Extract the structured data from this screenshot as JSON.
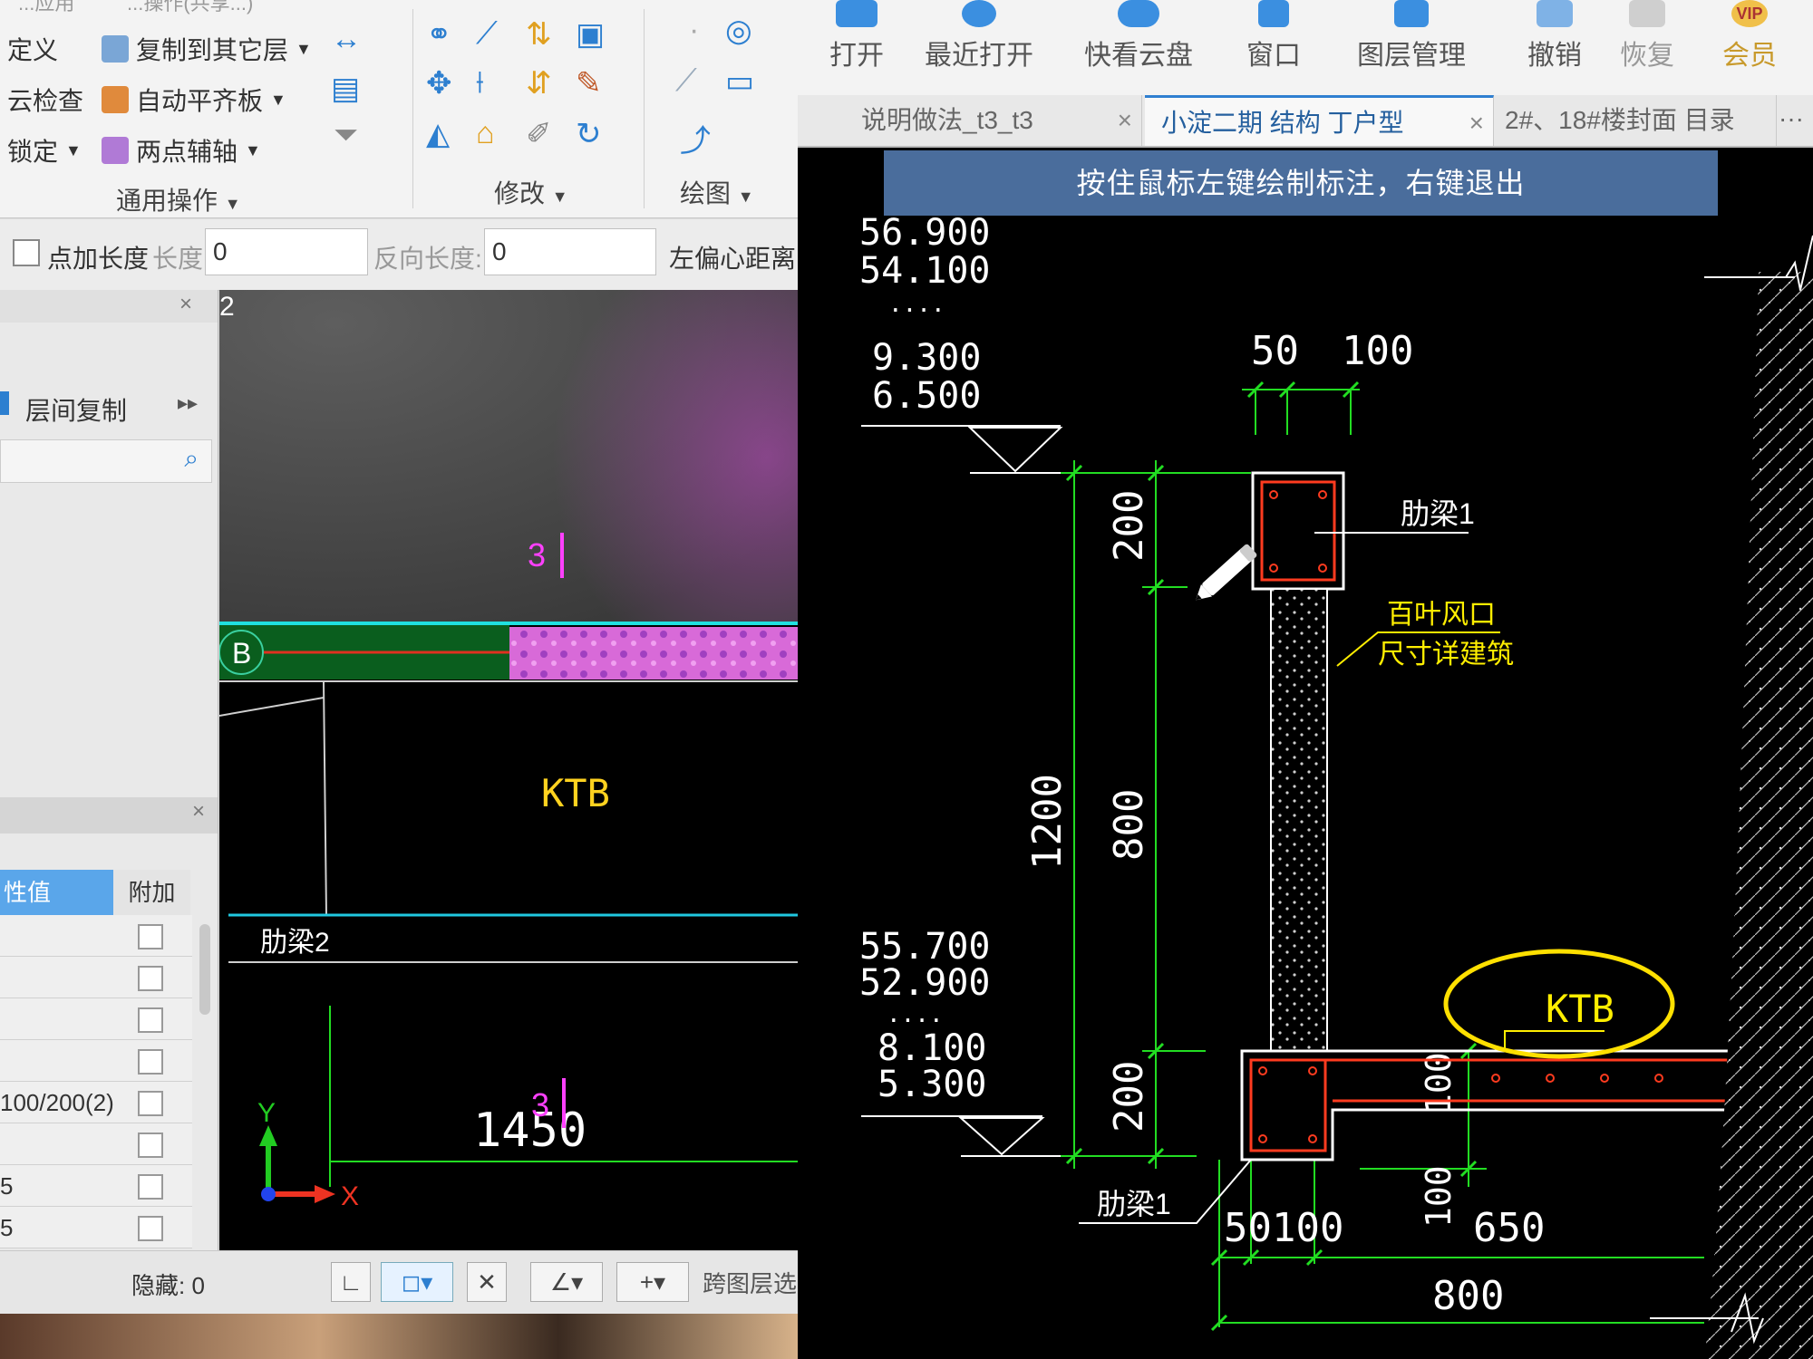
{
  "left_app": {
    "ribbon": {
      "partial_top_labels": [
        "...应用",
        "...操作(共享...)"
      ],
      "col1": [
        "定义",
        "云检查",
        "锁定"
      ],
      "col2": [
        "复制到其它层",
        "自动平齐板",
        "两点辅轴"
      ],
      "groups": {
        "common": "通用操作",
        "modify": "修改",
        "draw": "绘图"
      }
    },
    "prop_bar": {
      "checkbox_label": "点加长度",
      "length_label": "长度:",
      "length_value": "0",
      "reverse_label": "反向长度:",
      "reverse_value": "0",
      "offset_label": "左偏心距离"
    },
    "side_panel": {
      "tab_number": "2",
      "floor_copy": "层间复制",
      "props_header": {
        "value_col": "性值",
        "extra_col": "附加"
      },
      "values": [
        "",
        "",
        "",
        "",
        "100/200(2)",
        "",
        "5",
        "5"
      ],
      "hidden_label": "隐藏: 0"
    },
    "viewport": {
      "axis_label": "B",
      "dim_value": "1450",
      "mark_3a": "3",
      "mark_3b": "3",
      "ktb_label": "KTB",
      "beam_label": "肋梁2",
      "axis_y": "Y",
      "axis_x": "X"
    },
    "status": {
      "cross_layer": "跨图层选"
    }
  },
  "right_app": {
    "toolbar": [
      "打开",
      "最近打开",
      "快看云盘",
      "窗口",
      "图层管理",
      "撤销",
      "恢复",
      "会员"
    ],
    "vip_badge": "VIP",
    "tabs": [
      {
        "label": "说明做法_t3_t3",
        "active": false
      },
      {
        "label": "小淀二期 结构 丁户型",
        "active": true
      },
      {
        "label": "2#、18#楼封面 目录",
        "active": false
      }
    ],
    "tab_close": "×",
    "tabs_more": "···",
    "hint": "按住鼠标左键绘制标注，右键退出",
    "drawing": {
      "elev_top": [
        "56.900",
        "54.100",
        "....",
        "9.300",
        "6.500"
      ],
      "elev_bottom": [
        "55.700",
        "52.900",
        "....",
        "8.100",
        "5.300"
      ],
      "dims": {
        "top_50": "50",
        "top_100": "100",
        "v_200_top": "200",
        "v_800": "800",
        "v_1200": "1200",
        "v_200_bot": "200",
        "v_100a": "100",
        "v_100b": "100",
        "b_50100": "50100",
        "b_650": "650",
        "b_800": "800"
      },
      "labels": {
        "beam_top": "肋梁1",
        "beam_bottom": "肋梁1",
        "louver_1": "百叶风口",
        "louver_2": "尺寸详建筑",
        "ktb": "KTB"
      },
      "colors": {
        "dim": "#22dd22",
        "text": "#ffffff",
        "beam": "#ff3b1f",
        "note": "#ffee00",
        "annotation": "#ffe000",
        "mark": "#ff40ff"
      }
    }
  }
}
